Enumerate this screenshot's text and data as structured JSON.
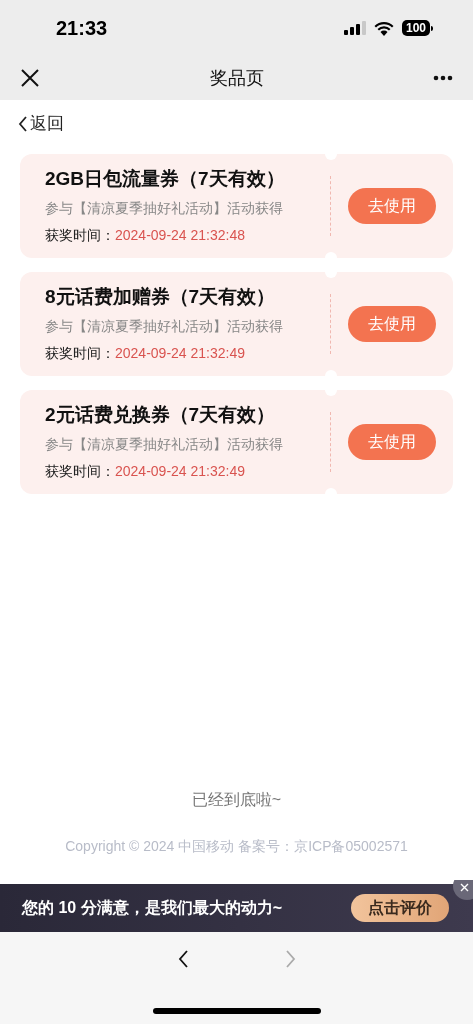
{
  "status_bar": {
    "time": "21:33",
    "battery": "100"
  },
  "nav_bar": {
    "title": "奖品页"
  },
  "back_link": "返回",
  "coupons": [
    {
      "title": "2GB日包流量券（7天有效）",
      "source": "参与【清凉夏季抽好礼活动】活动获得",
      "time_label": "获奖时间：",
      "time": "2024-09-24 21:32:48",
      "button": "去使用"
    },
    {
      "title": "8元话费加赠券（7天有效）",
      "source": "参与【清凉夏季抽好礼活动】活动获得",
      "time_label": "获奖时间：",
      "time": "2024-09-24 21:32:49",
      "button": "去使用"
    },
    {
      "title": "2元话费兑换券（7天有效）",
      "source": "参与【清凉夏季抽好礼活动】活动获得",
      "time_label": "获奖时间：",
      "time": "2024-09-24 21:32:49",
      "button": "去使用"
    }
  ],
  "end_text": "已经到底啦~",
  "copyright": "Copyright © 2024 中国移动 备案号：京ICP备05002571",
  "banner": {
    "text": "您的 10 分满意，是我们最大的动力~",
    "button": "点击评价"
  },
  "browser_nav": [
    {
      "kind": "back",
      "disabled": false
    },
    {
      "kind": "forward",
      "disabled": true
    }
  ]
}
